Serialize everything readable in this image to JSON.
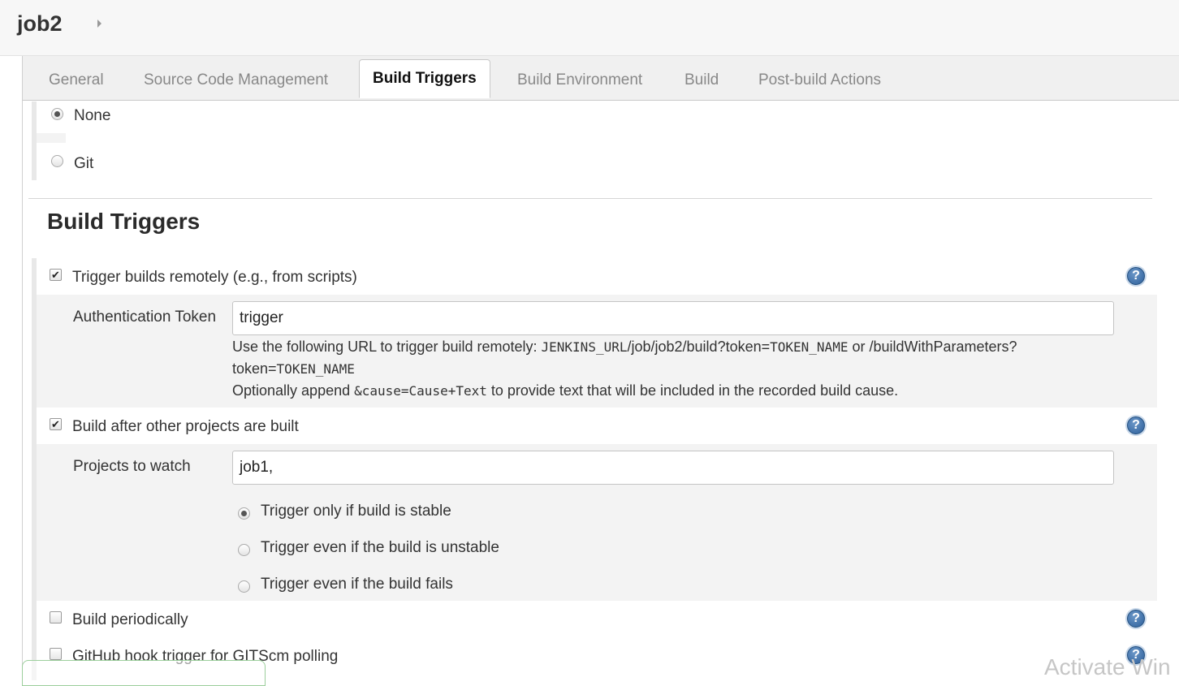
{
  "header": {
    "job_name": "job2"
  },
  "tabs": [
    {
      "label": "General"
    },
    {
      "label": "Source Code Management"
    },
    {
      "label": "Build Triggers"
    },
    {
      "label": "Build Environment"
    },
    {
      "label": "Build"
    },
    {
      "label": "Post-build Actions"
    }
  ],
  "active_tab": "Build Triggers",
  "scm": {
    "options": [
      {
        "label": "None",
        "selected": true
      },
      {
        "label": "Git",
        "selected": false
      }
    ]
  },
  "build_triggers": {
    "title": "Build Triggers",
    "remote": {
      "label": "Trigger builds remotely (e.g., from scripts)",
      "checked": true,
      "token_label": "Authentication Token",
      "token_value": "trigger",
      "help_1_prefix": "Use the following URL to trigger build remotely: ",
      "help_1_code1": "JENKINS_URL",
      "help_1_mid": "/job/job2/build?token=",
      "help_1_code2": "TOKEN_NAME",
      "help_1_suffix": " or /buildWithParameters?",
      "help_2_prefix": "token=",
      "help_2_code": "TOKEN_NAME",
      "help_3_prefix": "Optionally append ",
      "help_3_code": "&cause=Cause+Text",
      "help_3_suffix": " to provide text that will be included in the recorded build cause."
    },
    "after_other": {
      "label": "Build after other projects are built",
      "checked": true,
      "projects_label": "Projects to watch",
      "projects_value": "job1,",
      "options": [
        {
          "label": "Trigger only if build is stable",
          "selected": true
        },
        {
          "label": "Trigger even if the build is unstable",
          "selected": false
        },
        {
          "label": "Trigger even if the build fails",
          "selected": false
        }
      ]
    },
    "periodic": {
      "label": "Build periodically",
      "checked": false
    },
    "github": {
      "label": "GitHub hook trigger for GITScm polling",
      "checked": false
    }
  },
  "help_icon_glyph": "?",
  "check_glyph": "✔",
  "watermark": "Activate Win"
}
